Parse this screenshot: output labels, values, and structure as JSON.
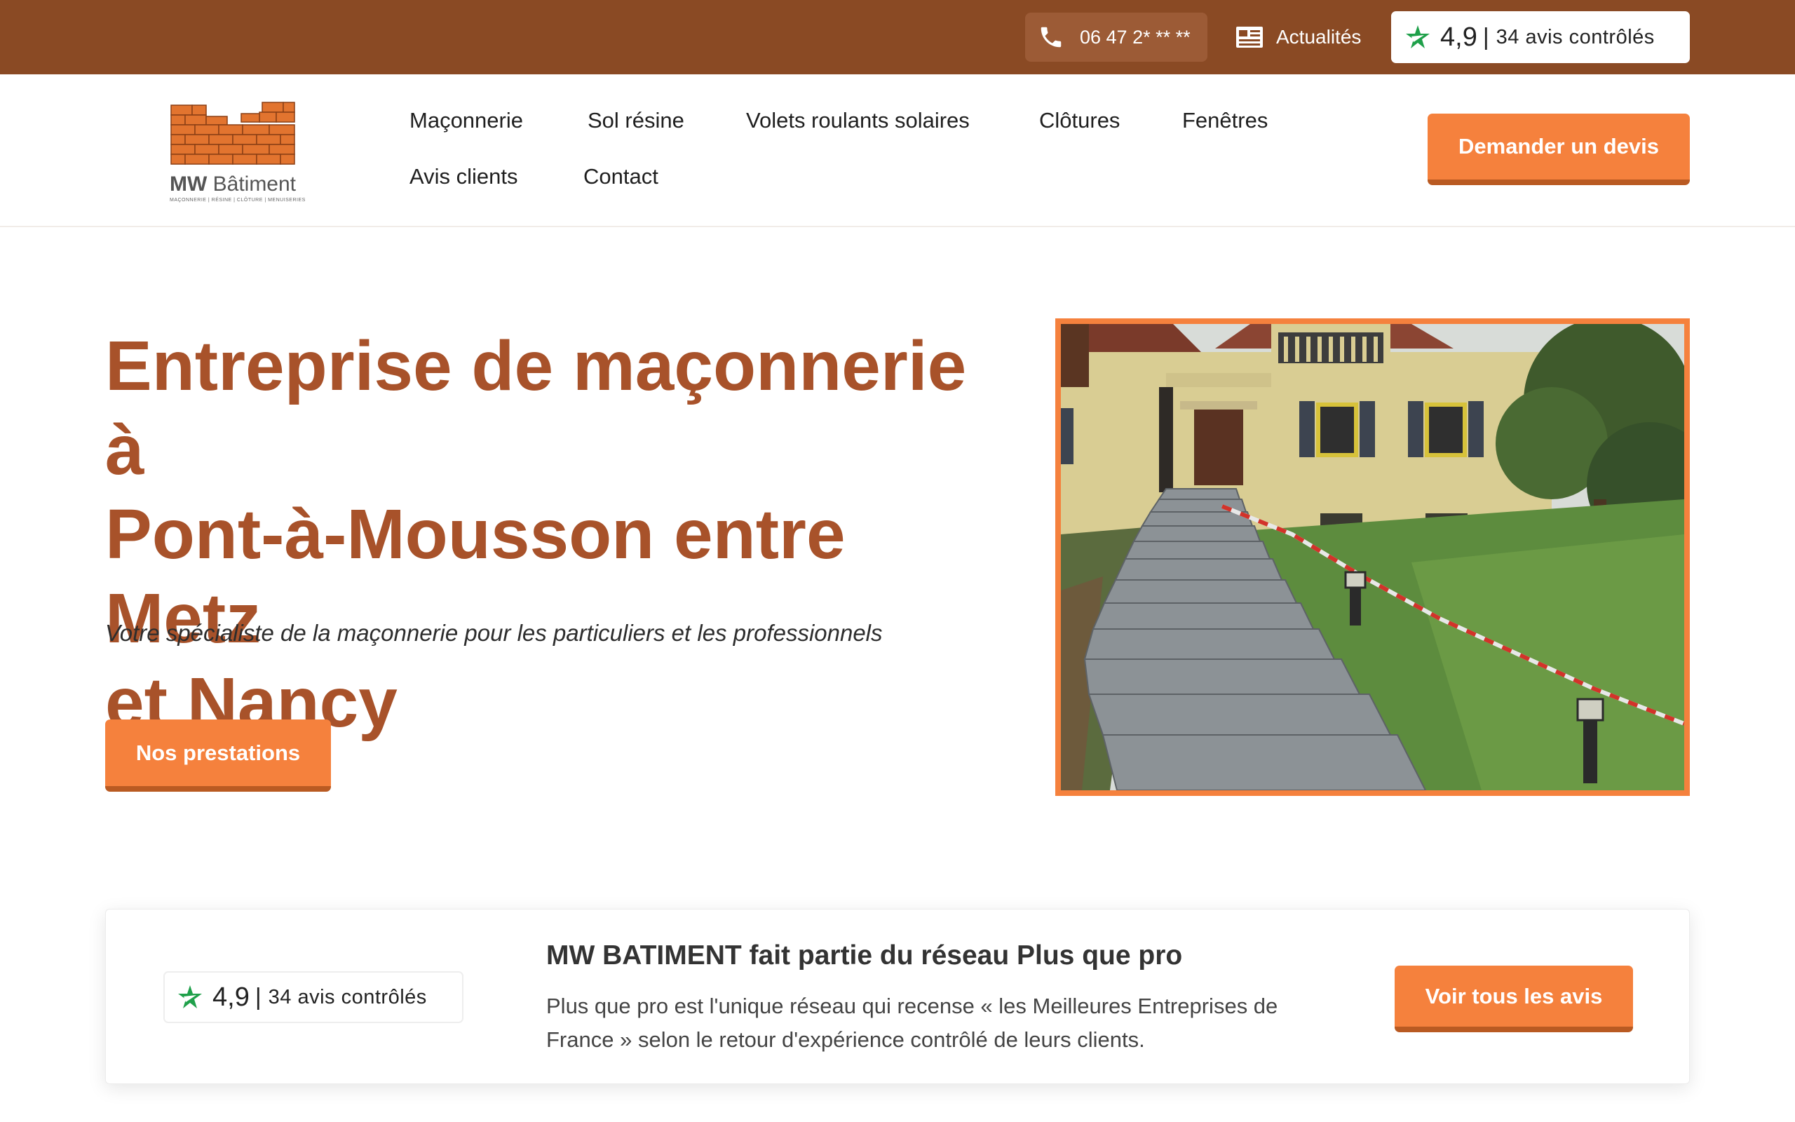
{
  "topbar": {
    "phone": "06 47 2* ** **",
    "news_label": "Actualités",
    "rating": {
      "score": "4,9",
      "separator": "|",
      "text": "34 avis contrôlés"
    }
  },
  "logo": {
    "name_bold": "MW",
    "name_rest": "Bâtiment",
    "tagline": "MAÇONNERIE | RÉSINE | CLÔTURE | MENUISERIES"
  },
  "nav": {
    "items": [
      {
        "label": "Maçonnerie"
      },
      {
        "label": "Sol résine"
      },
      {
        "label": "Volets roulants solaires"
      },
      {
        "label": "Clôtures"
      },
      {
        "label": "Fenêtres"
      },
      {
        "label": "Avis clients"
      },
      {
        "label": "Contact"
      }
    ],
    "cta_label": "Demander un devis"
  },
  "hero": {
    "title_lines": [
      "Entreprise de maçonnerie à",
      "Pont-à-Mousson entre Metz",
      "et Nancy"
    ],
    "subtitle": "Votre spécialiste de la maçonnerie pour les particuliers et les professionnels",
    "button_label": "Nos prestations"
  },
  "reviews": {
    "rating": {
      "score": "4,9",
      "separator": "|",
      "text": "34 avis contrôlés"
    },
    "title": "MW BATIMENT fait partie du réseau Plus que pro",
    "text": "Plus que pro est l'unique réseau qui recense « les Meilleures Entreprises de France » selon le retour d'expérience contrôlé de leurs clients.",
    "button_label": "Voir tous les avis"
  },
  "colors": {
    "topbar": "#8a4a24",
    "accent": "#f5813d",
    "accent_dark": "#b95a22",
    "title": "#a8522a",
    "rating_star": "#1fa04a"
  },
  "icons": {
    "phone": "phone-icon",
    "news": "newspaper-icon",
    "rating": "plus-que-pro-star-icon"
  }
}
